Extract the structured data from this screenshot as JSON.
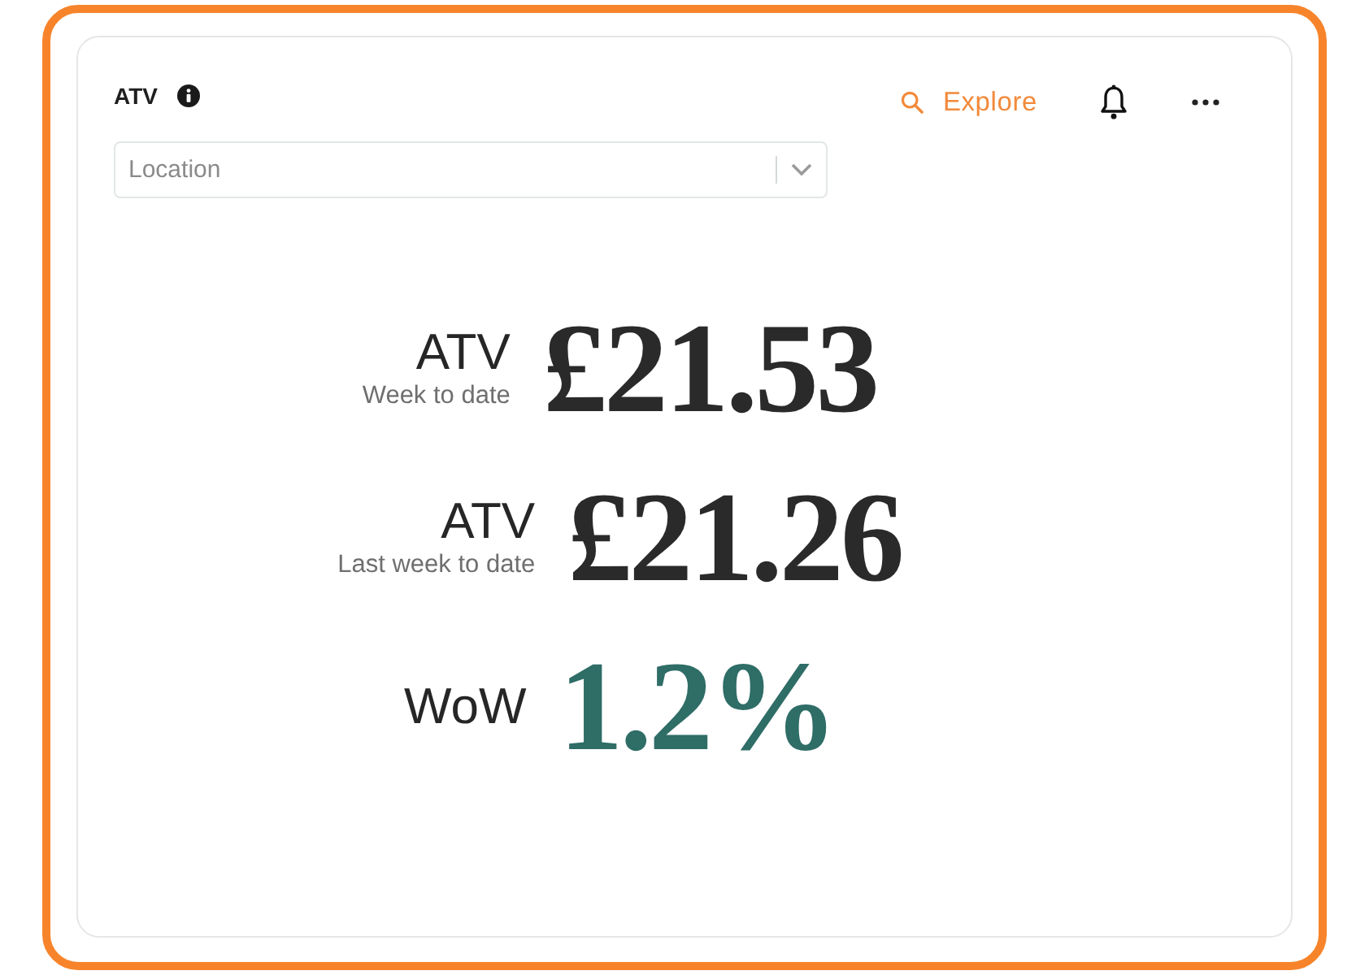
{
  "card": {
    "title": "ATV",
    "explore_label": "Explore",
    "location": {
      "placeholder": "Location"
    }
  },
  "metrics": [
    {
      "kind": "amount",
      "label": "ATV",
      "sublabel": "Week to date",
      "value": "£21.53"
    },
    {
      "kind": "amount",
      "label": "ATV",
      "sublabel": "Last week to date",
      "value": "£21.26"
    },
    {
      "kind": "change",
      "label": "WoW",
      "value": "1.2%"
    }
  ]
}
